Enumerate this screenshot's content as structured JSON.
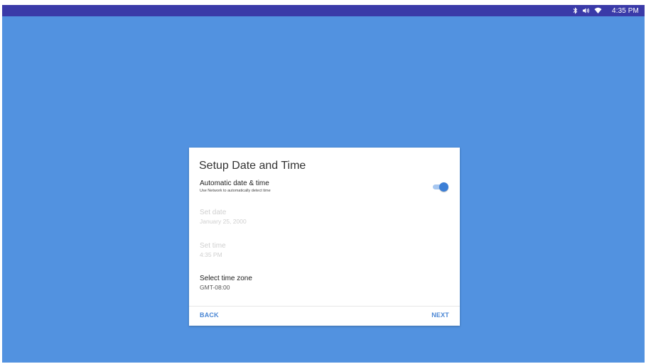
{
  "status_bar": {
    "icons": [
      "bluetooth-icon",
      "volume-icon",
      "wifi-icon"
    ],
    "time": "4:35 PM",
    "color": "#3a3aa8"
  },
  "background_color": "#5292e0",
  "dialog": {
    "title": "Setup Date and Time",
    "auto_datetime": {
      "label": "Automatic date & time",
      "description": "Use Network to automatically detect time",
      "enabled": true
    },
    "set_date": {
      "label": "Set date",
      "value": "January 25, 2000",
      "disabled": true
    },
    "set_time": {
      "label": "Set time",
      "value": "4:35 PM",
      "disabled": true
    },
    "time_zone": {
      "label": "Select time zone",
      "value": "GMT-08:00"
    },
    "back_label": "BACK",
    "next_label": "NEXT",
    "accent_color": "#4a86d4"
  }
}
